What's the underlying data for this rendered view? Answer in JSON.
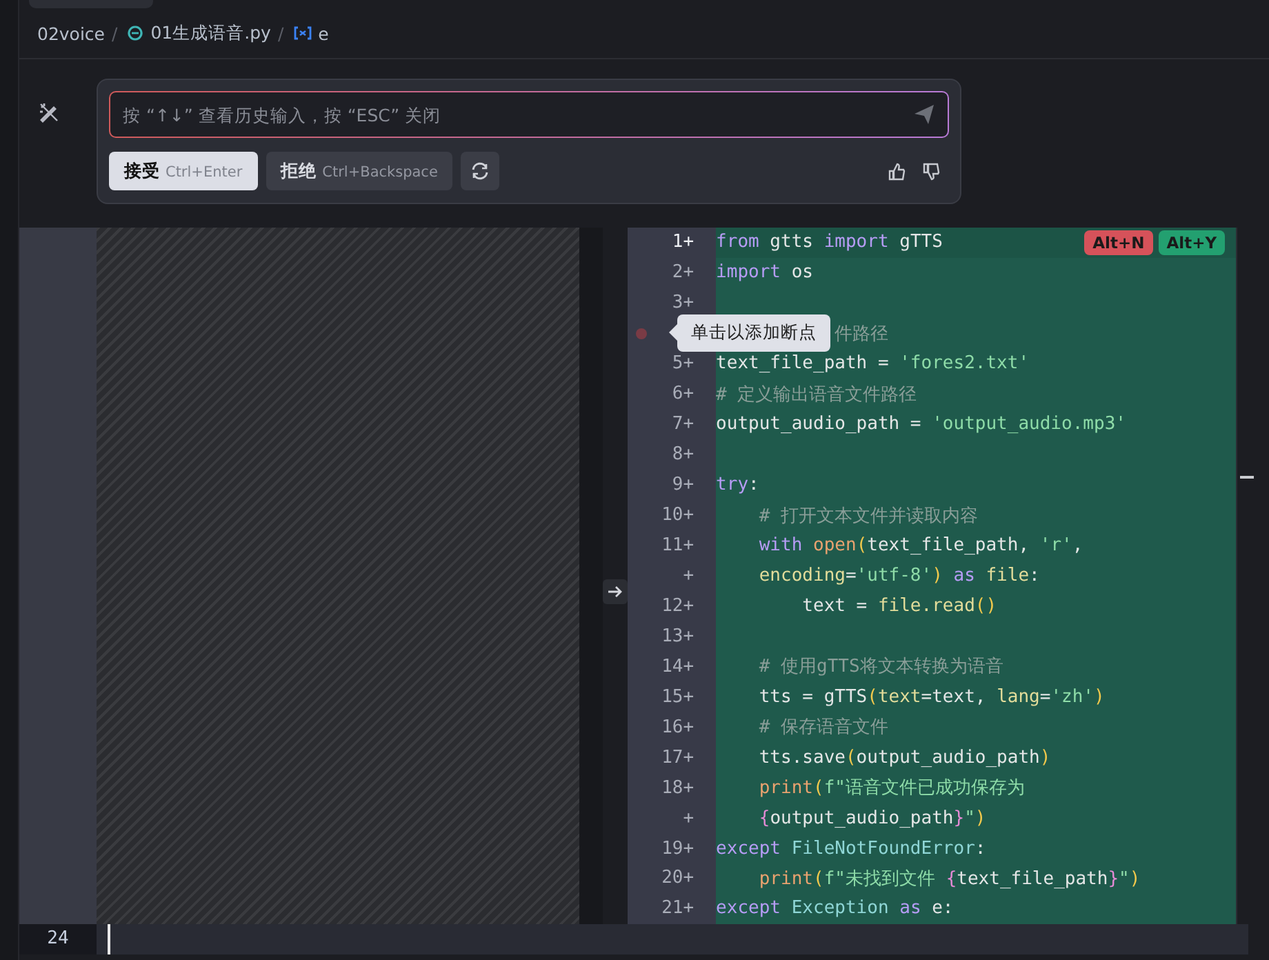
{
  "breadcrumb": [
    {
      "kind": "folder",
      "label": "02voice"
    },
    {
      "kind": "sep",
      "label": "/"
    },
    {
      "kind": "python",
      "label": "01生成语音.py"
    },
    {
      "kind": "sep",
      "label": "/"
    },
    {
      "kind": "symbol",
      "label": "e"
    }
  ],
  "prompt": {
    "placeholder": "按 “↑↓” 查看历史输入，按 “ESC” 关闭",
    "buttons": [
      {
        "kind": "primary",
        "label": "接受",
        "shortcut": "Ctrl+Enter"
      },
      {
        "kind": "secondary",
        "label": "拒绝",
        "shortcut": "Ctrl+Backspace"
      }
    ]
  },
  "diff": {
    "reject_key": "Alt+N",
    "accept_key": "Alt+Y",
    "tooltip": "单击以添加断点",
    "lines": [
      {
        "number": "1+",
        "tokens": [
          {
            "kind": "kw",
            "text": "from"
          },
          {
            "kind": "pl",
            "text": " gtts "
          },
          {
            "kind": "kw",
            "text": "import"
          },
          {
            "kind": "pl",
            "text": " gTTS"
          }
        ]
      },
      {
        "number": "2+",
        "tokens": [
          {
            "kind": "kw",
            "text": "import"
          },
          {
            "kind": "pl",
            "text": " os"
          }
        ]
      },
      {
        "number": "3+"
      },
      {
        "covered": true,
        "breakpoint": true,
        "tokens": [
          {
            "kind": "cm",
            "text": "件路径"
          }
        ]
      },
      {
        "number": "5+",
        "tokens": [
          {
            "kind": "pl",
            "text": "text_file_path = "
          },
          {
            "kind": "str",
            "text": "'fores2.txt'"
          }
        ]
      },
      {
        "number": "6+",
        "tokens": [
          {
            "kind": "cm",
            "text": "# 定义输出语音文件路径"
          }
        ]
      },
      {
        "number": "7+",
        "tokens": [
          {
            "kind": "pl",
            "text": "output_audio_path = "
          },
          {
            "kind": "str",
            "text": "'output_audio.mp3'"
          }
        ]
      },
      {
        "number": "8+"
      },
      {
        "number": "9+",
        "tokens": [
          {
            "kind": "kw",
            "text": "try"
          },
          {
            "kind": "pl",
            "text": ":"
          }
        ]
      },
      {
        "number": "10+",
        "tokens": [
          {
            "kind": "cm",
            "text": "    # 打开文本文件并读取内容"
          }
        ]
      },
      {
        "number": "11+",
        "tokens": [
          {
            "kind": "kw",
            "text": "    with"
          },
          {
            "kind": "fn",
            "text": " open"
          },
          {
            "kind": "par",
            "text": "("
          },
          {
            "kind": "pl",
            "text": "text_file_path, "
          },
          {
            "kind": "str",
            "text": "'r'"
          },
          {
            "kind": "pl",
            "text": ","
          }
        ]
      },
      {
        "number": "+",
        "tokens": [
          {
            "kind": "arg",
            "text": "    encoding"
          },
          {
            "kind": "pl",
            "text": "="
          },
          {
            "kind": "str",
            "text": "'utf-8'"
          },
          {
            "kind": "par",
            "text": ")"
          },
          {
            "kind": "kw",
            "text": " as"
          },
          {
            "kind": "arg",
            "text": " file"
          },
          {
            "kind": "pl",
            "text": ":"
          }
        ]
      },
      {
        "number": "12+",
        "tokens": [
          {
            "kind": "pl",
            "text": "        text = "
          },
          {
            "kind": "arg",
            "text": "file.read"
          },
          {
            "kind": "par",
            "text": "()"
          }
        ]
      },
      {
        "number": "13+"
      },
      {
        "number": "14+",
        "tokens": [
          {
            "kind": "cm",
            "text": "    # 使用gTTS将文本转换为语音"
          }
        ]
      },
      {
        "number": "15+",
        "tokens": [
          {
            "kind": "pl",
            "text": "    tts = gTTS"
          },
          {
            "kind": "par",
            "text": "("
          },
          {
            "kind": "arg",
            "text": "text"
          },
          {
            "kind": "pl",
            "text": "=text, "
          },
          {
            "kind": "arg",
            "text": "lang"
          },
          {
            "kind": "pl",
            "text": "="
          },
          {
            "kind": "str",
            "text": "'zh'"
          },
          {
            "kind": "par",
            "text": ")"
          }
        ]
      },
      {
        "number": "16+",
        "tokens": [
          {
            "kind": "cm",
            "text": "    # 保存语音文件"
          }
        ]
      },
      {
        "number": "17+",
        "tokens": [
          {
            "kind": "pl",
            "text": "    tts.save"
          },
          {
            "kind": "par",
            "text": "("
          },
          {
            "kind": "pl",
            "text": "output_audio_path"
          },
          {
            "kind": "par",
            "text": ")"
          }
        ]
      },
      {
        "number": "18+",
        "tokens": [
          {
            "kind": "fn",
            "text": "    print"
          },
          {
            "kind": "par",
            "text": "("
          },
          {
            "kind": "str",
            "text": "f\"语音文件已成功保存为"
          }
        ]
      },
      {
        "number": "+",
        "tokens": [
          {
            "kind": "br",
            "text": "    {"
          },
          {
            "kind": "pl",
            "text": "output_audio_path"
          },
          {
            "kind": "br",
            "text": "}"
          },
          {
            "kind": "str",
            "text": "\""
          },
          {
            "kind": "par",
            "text": ")"
          }
        ]
      },
      {
        "number": "19+",
        "tokens": [
          {
            "kind": "kw",
            "text": "except"
          },
          {
            "kind": "cls",
            "text": " FileNotFoundError"
          },
          {
            "kind": "pl",
            "text": ":"
          }
        ]
      },
      {
        "number": "20+",
        "tokens": [
          {
            "kind": "fn",
            "text": "    print"
          },
          {
            "kind": "par",
            "text": "("
          },
          {
            "kind": "str",
            "text": "f\"未找到文件 "
          },
          {
            "kind": "br",
            "text": "{"
          },
          {
            "kind": "pl",
            "text": "text_file_path"
          },
          {
            "kind": "br",
            "text": "}"
          },
          {
            "kind": "str",
            "text": "\""
          },
          {
            "kind": "par",
            "text": ")"
          }
        ]
      },
      {
        "number": "21+",
        "tokens": [
          {
            "kind": "kw",
            "text": "except"
          },
          {
            "kind": "cls",
            "text": " Exception"
          },
          {
            "kind": "kw",
            "text": " as"
          },
          {
            "kind": "pl",
            "text": " e:"
          }
        ]
      }
    ]
  },
  "editor": {
    "line_number": "24"
  }
}
